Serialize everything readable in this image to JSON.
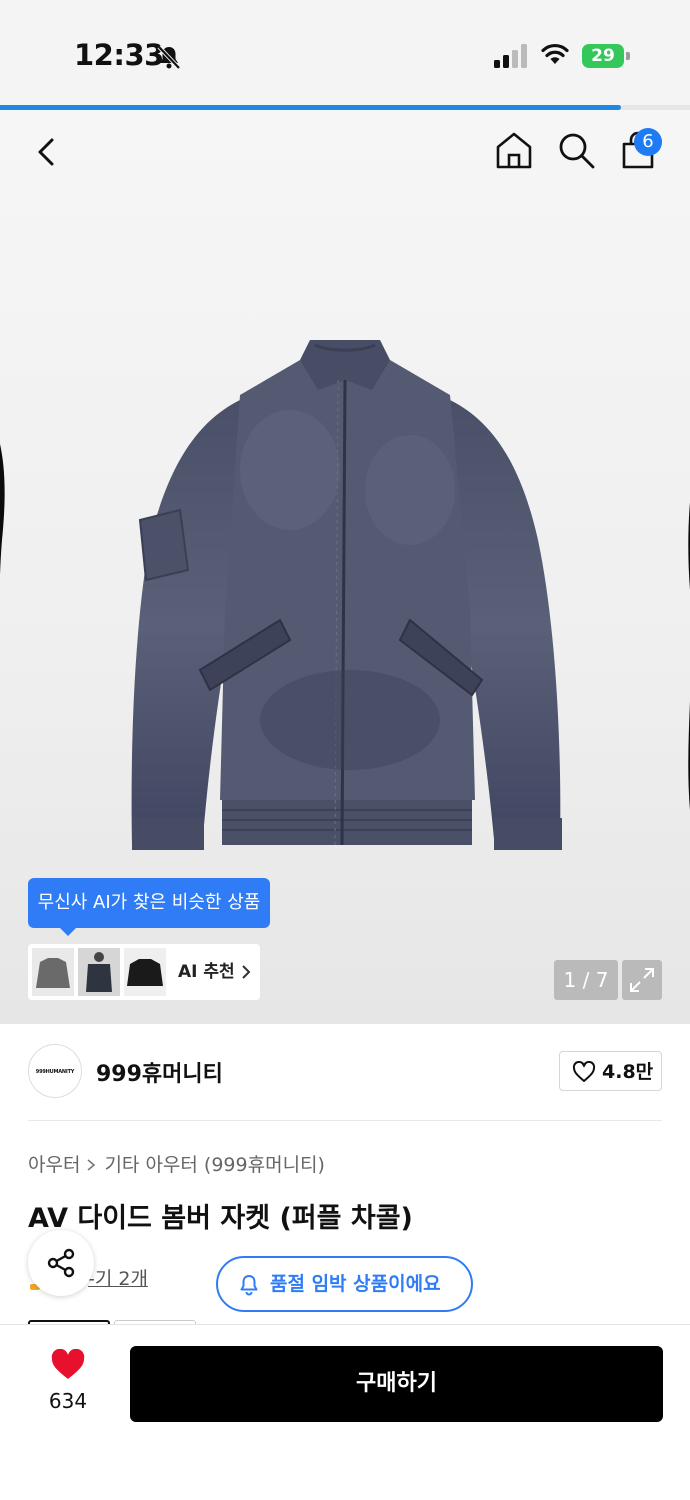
{
  "status_bar": {
    "time": "12:33",
    "battery": "29"
  },
  "progress": {
    "fraction": 0.9
  },
  "nav": {
    "cart_badge": "6"
  },
  "gallery": {
    "ai_tooltip": "무신사 AI가 찾은 비슷한 상품",
    "ai_recommend_label": "AI 추천",
    "page_counter": "1 / 7"
  },
  "brand": {
    "logo_text": "999HUMANITY",
    "name": "999휴머니티",
    "likes": "4.8만"
  },
  "product": {
    "breadcrumb": [
      "아우터",
      "기타 아우터 (999휴머니티)"
    ],
    "title": "AV 다이드 봄버 자켓 (퍼플 차콜)",
    "review_link": "-기 2개",
    "soldout_notice": "품절 임박 상품이에요"
  },
  "bottom_bar": {
    "wish_count": "634",
    "buy_label": "구매하기"
  },
  "colors": {
    "accent": "#2f7cf6",
    "heart": "#e8112d",
    "buy_button": "#000000",
    "battery": "#34c759"
  },
  "icons": [
    "bell-off-icon",
    "signal-icon",
    "wifi-icon",
    "back-icon",
    "home-icon",
    "search-icon",
    "cart-icon",
    "chevron-right-icon",
    "expand-icon",
    "heart-outline-icon",
    "share-icon",
    "bell-icon",
    "heart-filled-icon"
  ]
}
